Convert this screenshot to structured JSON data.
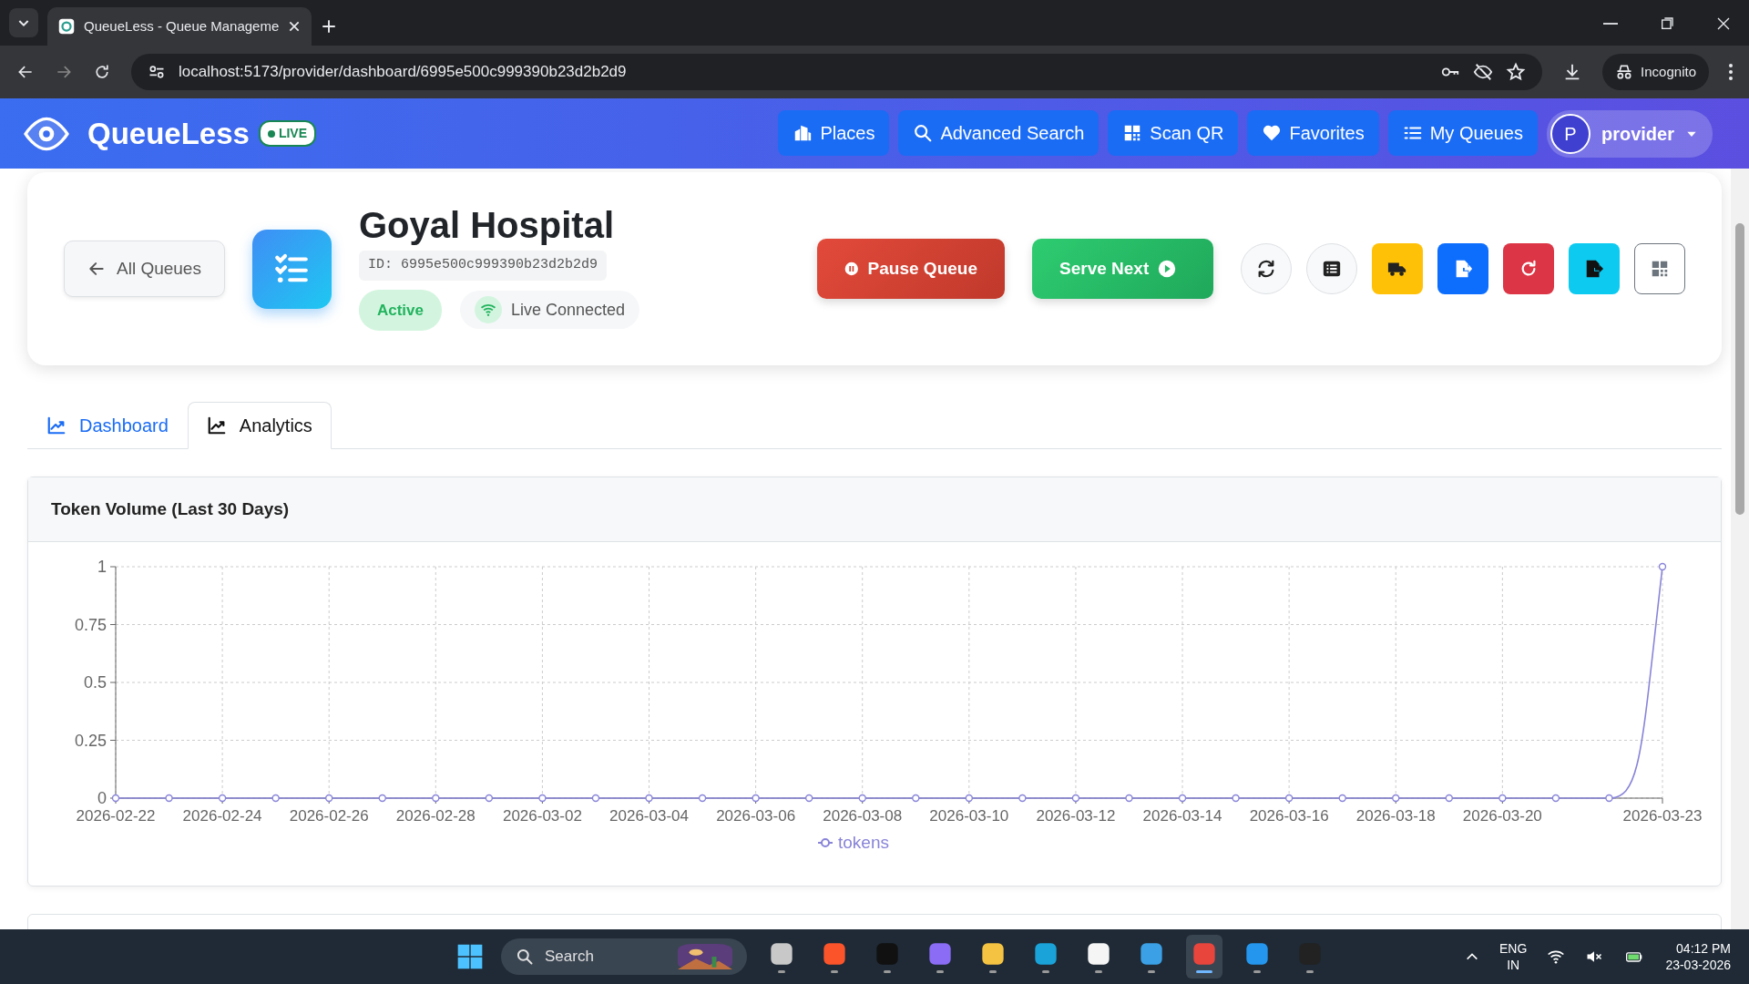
{
  "browser": {
    "tab_title": "QueueLess - Queue Manageme",
    "url": "localhost:5173/provider/dashboard/6995e500c999390b23d2b2d9",
    "profile": "Incognito"
  },
  "navbar": {
    "brand": "QueueLess",
    "badge": "LIVE",
    "items": [
      {
        "label": "Places"
      },
      {
        "label": "Advanced Search"
      },
      {
        "label": "Scan QR"
      },
      {
        "label": "Favorites"
      },
      {
        "label": "My Queues"
      }
    ],
    "user": {
      "initial": "P",
      "name": "provider"
    }
  },
  "header": {
    "back": "All Queues",
    "title": "Goyal Hospital",
    "id": "ID: 6995e500c999390b23d2b2d9",
    "status": "Active",
    "connection": "Live Connected",
    "pause": "Pause Queue",
    "serve": "Serve Next",
    "icon_buttons": [
      {
        "kind": "refresh"
      },
      {
        "kind": "list"
      },
      {
        "kind": "truck"
      },
      {
        "kind": "export"
      },
      {
        "kind": "redo"
      },
      {
        "kind": "exit"
      },
      {
        "kind": "qr"
      }
    ]
  },
  "tabs": [
    {
      "label": "Dashboard",
      "selected": false
    },
    {
      "label": "Analytics",
      "selected": true
    }
  ],
  "card": {
    "title": "Token Volume (Last 30 Days)",
    "chart_data": {
      "type": "line",
      "grid": true,
      "categories": [
        "2026-02-22",
        null,
        "2026-02-24",
        null,
        "2026-02-26",
        null,
        "2026-02-28",
        null,
        "2026-03-02",
        null,
        "2026-03-04",
        null,
        "2026-03-06",
        null,
        "2026-03-08",
        null,
        "2026-03-10",
        null,
        "2026-03-12",
        null,
        "2026-03-14",
        null,
        "2026-03-16",
        null,
        "2026-03-18",
        null,
        "2026-03-20",
        null,
        null,
        "2026-03-23"
      ],
      "series": [
        {
          "name": "tokens",
          "color": "#8884d8",
          "marker": "circle",
          "values": [
            0,
            0,
            0,
            0,
            0,
            0,
            0,
            0,
            0,
            0,
            0,
            0,
            0,
            0,
            0,
            0,
            0,
            0,
            0,
            0,
            0,
            0,
            0,
            0,
            0,
            0,
            0,
            0,
            0,
            1
          ]
        }
      ],
      "ylim": [
        0,
        1
      ],
      "yticks": [
        {
          "value": 0,
          "label": "0"
        },
        {
          "value": 0.25,
          "label": "0.25"
        },
        {
          "value": 0.5,
          "label": "0.5"
        },
        {
          "value": 0.75,
          "label": "0.75"
        },
        {
          "value": 1,
          "label": "1"
        }
      ]
    }
  },
  "taskbar": {
    "search": "Search",
    "apps": [
      {
        "kind": "files",
        "selected": false
      },
      {
        "kind": "brave",
        "selected": false
      },
      {
        "kind": "ide",
        "selected": false
      },
      {
        "kind": "copilot",
        "selected": false
      },
      {
        "kind": "folder",
        "selected": false
      },
      {
        "kind": "edge",
        "selected": false
      },
      {
        "kind": "store",
        "selected": false
      },
      {
        "kind": "remote",
        "selected": false
      },
      {
        "kind": "chrome",
        "selected": true
      },
      {
        "kind": "docker",
        "selected": false
      },
      {
        "kind": "terminal",
        "selected": false
      }
    ],
    "lang": "ENG",
    "region": "IN",
    "time": "04:12 PM",
    "date": "23-03-2026"
  }
}
